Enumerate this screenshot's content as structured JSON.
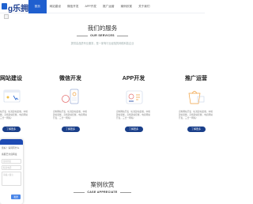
{
  "brand": {
    "logo_text": "g乐拥"
  },
  "nav": {
    "items": [
      {
        "label": "首页",
        "active": true
      },
      {
        "label": "网站建设",
        "active": false
      },
      {
        "label": "微信开发",
        "active": false
      },
      {
        "label": "APP开发",
        "active": false
      },
      {
        "label": "推广运营",
        "active": false
      },
      {
        "label": "案例欣赏",
        "active": false
      },
      {
        "label": "关于我们",
        "active": false
      }
    ]
  },
  "services": {
    "title": "我们的服务",
    "subtitle": "OUR SERVICES",
    "desc": "提供高品质专业服务，是一家有行业经验的网络科技企业"
  },
  "cards": [
    {
      "title": "网站建设",
      "desc": "定制网站开发（标准建站套餐，中端建站套餐，高端建站套餐，电商网站开发，三合一网站）",
      "button": "了解更多"
    },
    {
      "title": "微信开发",
      "desc": "定制网站开发（标准建站套餐，中端建站套餐，高端建站套餐，电商网站开发，三合一网站）",
      "button": "了解更多"
    },
    {
      "title": "APP开发",
      "desc": "定制网站开发（标准建站套餐，中端建站套餐，高端建站套餐，电商网站开发，三合一网站）",
      "button": "了解更多"
    },
    {
      "title": "推广运营",
      "desc": "定制网站开发（标准建站套餐，中端建站套餐，高端建站套餐，电商网站开发，三合一网站）",
      "button": "了解更多"
    }
  ],
  "chat": {
    "greeting": "您好！请问有什么",
    "line2": "客服已为您转接",
    "name_placeholder": "您的姓名",
    "phone_placeholder": "联系电话",
    "message_placeholder": "请输入留言",
    "send": "发送"
  },
  "cases": {
    "title": "案例欣赏",
    "subtitle": "CASE APPRECIATE"
  },
  "colors": {
    "primary": "#1f5fcf",
    "button": "#1a3f8a",
    "chat_header": "#1d4ab3"
  }
}
